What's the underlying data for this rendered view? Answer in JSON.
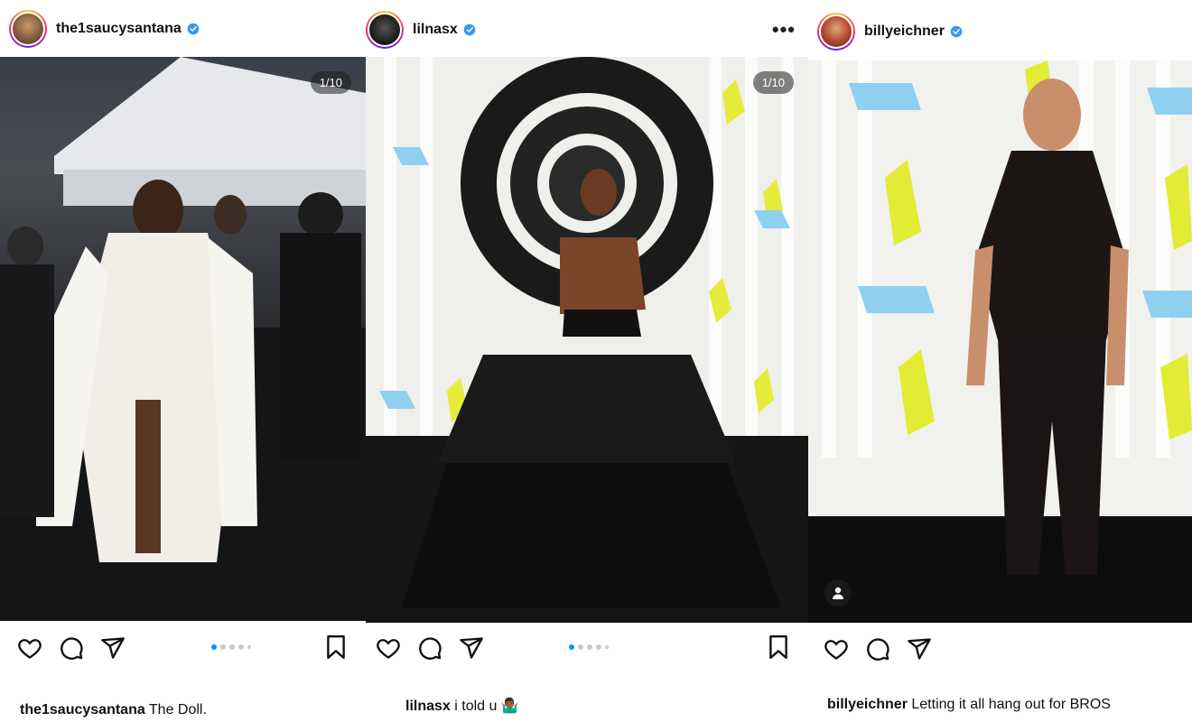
{
  "posts": [
    {
      "username": "the1saucysantana",
      "verified": true,
      "counter": "1/10",
      "caption_user": "the1saucysantana",
      "caption_text": "The Doll.",
      "carousel": {
        "count": 5,
        "active": 0
      },
      "avatar_color": "#8a6a4a"
    },
    {
      "username": "lilnasx",
      "verified": true,
      "counter": "1/10",
      "caption_user": "lilnasx",
      "caption_text": "i told u 🤷🏾‍♂️",
      "carousel": {
        "count": 5,
        "active": 0
      },
      "more_label": "•••",
      "avatar_color": "#2a2a2a"
    },
    {
      "username": "billyeichner",
      "verified": true,
      "caption_user": "billyeichner",
      "caption_text": "Letting it all hang out for BROS",
      "avatar_color": "#b5452d"
    }
  ],
  "colors": {
    "accent": "#0095f6",
    "verified": "#3897f0",
    "text": "#111111"
  },
  "icons": [
    "heart-icon",
    "comment-icon",
    "share-icon",
    "bookmark-icon",
    "verified-icon",
    "person-tag-icon"
  ]
}
